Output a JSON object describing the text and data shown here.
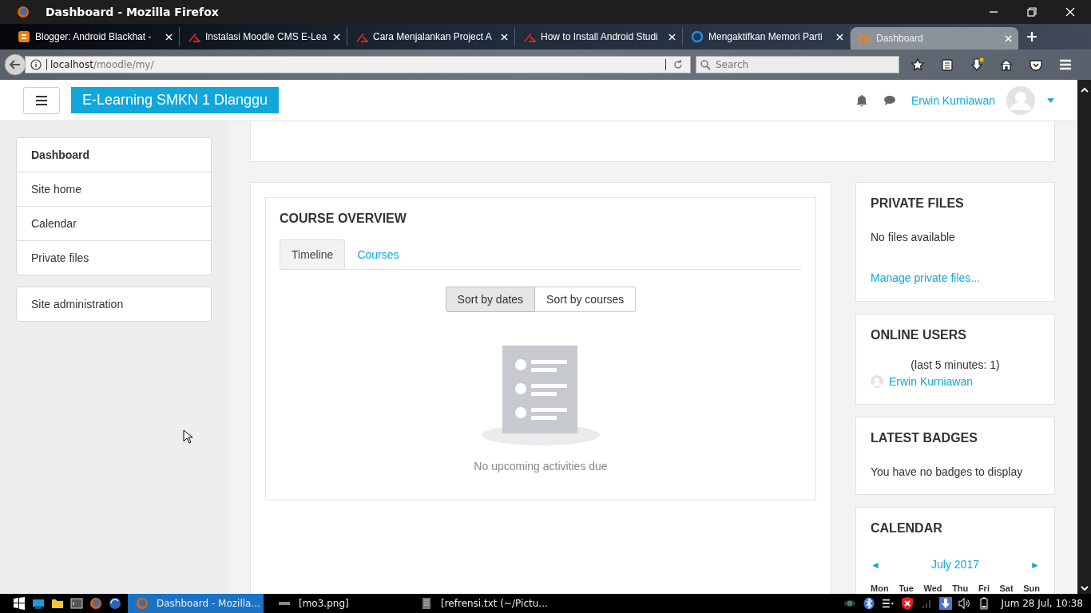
{
  "window": {
    "title": "Dashboard - Mozilla Firefox"
  },
  "browser_tabs": [
    {
      "label": "Blogger: Android Blackhat -",
      "kind": "blogger",
      "selected": false
    },
    {
      "label": "Instalasi Moodle CMS E-Lea",
      "kind": "dz",
      "selected": false
    },
    {
      "label": "Cara Menjalankan Project A",
      "kind": "dz",
      "selected": false
    },
    {
      "label": "How to Install Android Studi",
      "kind": "dz",
      "selected": false
    },
    {
      "label": "Mengaktifkan Memori Parti",
      "kind": "ring",
      "selected": false
    },
    {
      "label": "Dashboard",
      "kind": "moodle",
      "selected": true
    }
  ],
  "address_bar": {
    "host": "localhost",
    "path": "/moodle/my/"
  },
  "search": {
    "placeholder": "Search"
  },
  "site": {
    "brand": "E-Learning SMKN 1 Dlanggu",
    "user": "Erwin Kurniawan"
  },
  "nav_groups": [
    [
      {
        "label": "Dashboard",
        "selected": true
      },
      {
        "label": "Site home",
        "selected": false
      },
      {
        "label": "Calendar",
        "selected": false
      },
      {
        "label": "Private files",
        "selected": false
      }
    ],
    [
      {
        "label": "Site administration",
        "selected": false
      }
    ]
  ],
  "course_overview": {
    "title": "COURSE OVERVIEW",
    "tabs": [
      {
        "label": "Timeline",
        "selected": true
      },
      {
        "label": "Courses",
        "selected": false
      }
    ],
    "sort": [
      {
        "label": "Sort by dates",
        "selected": true
      },
      {
        "label": "Sort by courses",
        "selected": false
      }
    ],
    "empty": "No upcoming activities due"
  },
  "private_files": {
    "title": "PRIVATE FILES",
    "text": "No files available",
    "link": "Manage private files..."
  },
  "online_users": {
    "title": "ONLINE USERS",
    "note": "(last 5 minutes: 1)",
    "users": [
      "Erwin Kurniawan"
    ]
  },
  "latest_badges": {
    "title": "LATEST BADGES",
    "text": "You have no badges to display"
  },
  "calendar": {
    "title": "CALENDAR",
    "prev": "◄",
    "month": "July 2017",
    "next": "►",
    "weekdays": [
      "Mon",
      "Tue",
      "Wed",
      "Thu",
      "Fri",
      "Sat",
      "Sun"
    ]
  },
  "taskbar": {
    "items": [
      {
        "label": "Dashboard - Mozilla...",
        "kind": "firefox",
        "selected": true
      },
      {
        "label": "[mo3.png]",
        "kind": "image",
        "selected": false
      },
      {
        "label": "[refrensi.txt (~/Pictu...",
        "kind": "note",
        "selected": false
      }
    ],
    "clock": "Jum 28 Jul, 10:38"
  }
}
